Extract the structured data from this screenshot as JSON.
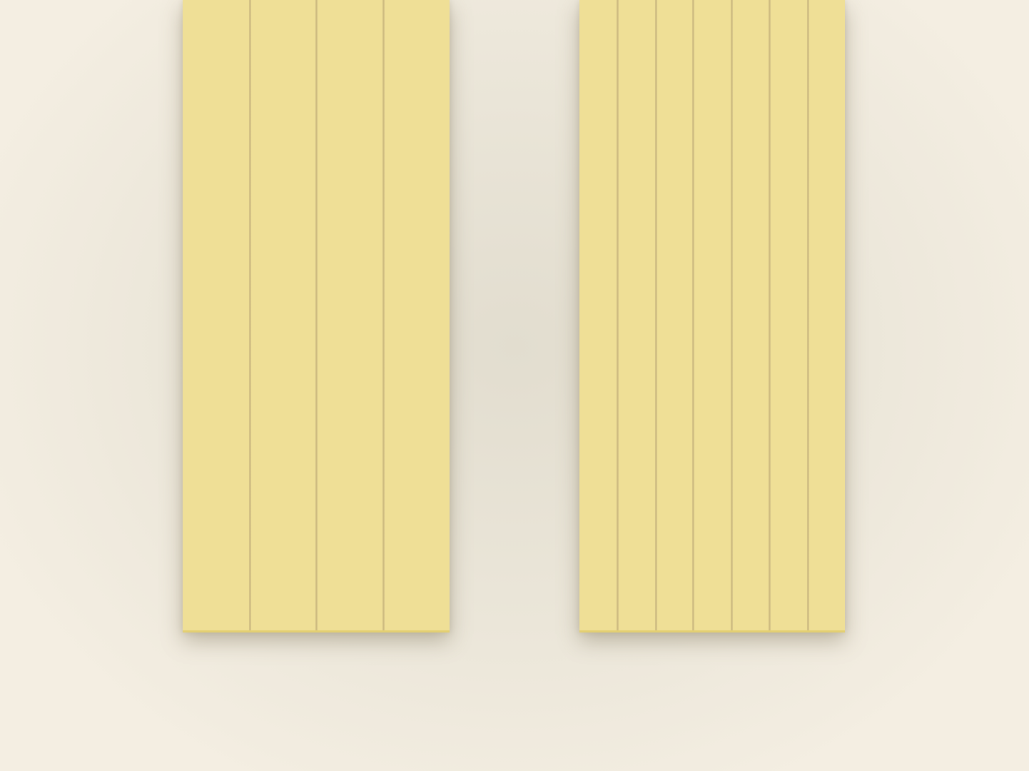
{
  "scene": {
    "background_color": "#f3ede1",
    "panel_color": "#efdf96",
    "divider_color": "#c9b67c",
    "panels": [
      {
        "name": "left-panel",
        "sections": 4
      },
      {
        "name": "right-panel",
        "sections": 7
      }
    ]
  }
}
